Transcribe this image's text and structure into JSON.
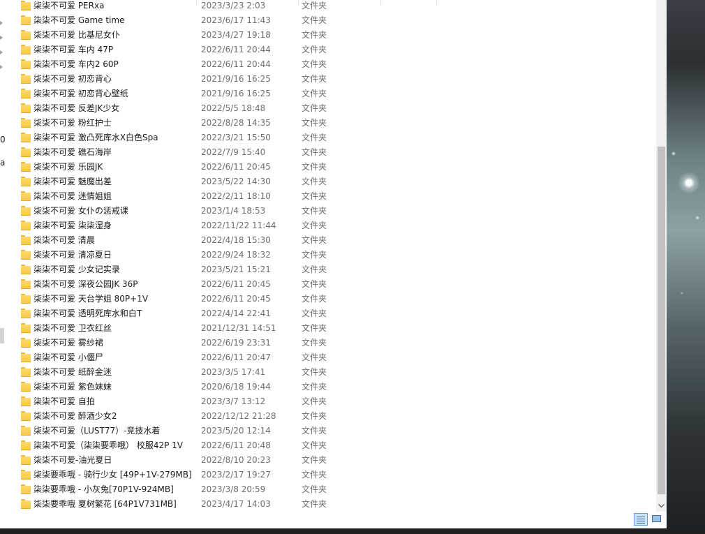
{
  "explorer": {
    "nav_fragments": [
      "0",
      "a"
    ],
    "rows": [
      {
        "name": "柒柒不可爱 PERxa",
        "date": "2023/3/23 2:03",
        "type": "文件夹"
      },
      {
        "name": "柒柒不可爱 Game time",
        "date": "2023/6/17 11:43",
        "type": "文件夹"
      },
      {
        "name": "柒柒不可爱 比基尼女仆",
        "date": "2023/4/27 19:18",
        "type": "文件夹"
      },
      {
        "name": "柒柒不可爱 车内 47P",
        "date": "2022/6/11 20:44",
        "type": "文件夹"
      },
      {
        "name": "柒柒不可爱 车内2 60P",
        "date": "2022/6/11 20:44",
        "type": "文件夹"
      },
      {
        "name": "柒柒不可爱 初恋背心",
        "date": "2021/9/16 16:25",
        "type": "文件夹"
      },
      {
        "name": "柒柒不可爱 初恋背心壁纸",
        "date": "2021/9/16 16:25",
        "type": "文件夹"
      },
      {
        "name": "柒柒不可爱 反差JK少女",
        "date": "2022/5/5 18:48",
        "type": "文件夹"
      },
      {
        "name": "柒柒不可爱 粉红护士",
        "date": "2022/8/28 14:35",
        "type": "文件夹"
      },
      {
        "name": "柒柒不可爱 激凸死库水X白色Spa",
        "date": "2022/3/21 15:50",
        "type": "文件夹"
      },
      {
        "name": "柒柒不可爱 礁石海岸",
        "date": "2022/7/9 15:40",
        "type": "文件夹"
      },
      {
        "name": "柒柒不可爱 乐园JK",
        "date": "2022/6/11 20:45",
        "type": "文件夹"
      },
      {
        "name": "柒柒不可爱 魅魔出差",
        "date": "2023/5/22 14:30",
        "type": "文件夹"
      },
      {
        "name": "柒柒不可爱 迷情姐姐",
        "date": "2022/2/11 18:10",
        "type": "文件夹"
      },
      {
        "name": "柒柒不可爱 女仆の惩戒课",
        "date": "2023/1/4 18:53",
        "type": "文件夹"
      },
      {
        "name": "柒柒不可爱 柒柒湿身",
        "date": "2022/11/22 11:44",
        "type": "文件夹"
      },
      {
        "name": "柒柒不可爱 清晨",
        "date": "2022/4/18 15:30",
        "type": "文件夹"
      },
      {
        "name": "柒柒不可爱 清凉夏日",
        "date": "2022/9/24 18:32",
        "type": "文件夹"
      },
      {
        "name": "柒柒不可爱 少女记实录",
        "date": "2023/5/21 15:21",
        "type": "文件夹"
      },
      {
        "name": "柒柒不可爱 深夜公园JK 36P",
        "date": "2022/6/11 20:45",
        "type": "文件夹"
      },
      {
        "name": "柒柒不可爱 天台学姐 80P+1V",
        "date": "2022/6/11 20:45",
        "type": "文件夹"
      },
      {
        "name": "柒柒不可爱 透明死库水和白T",
        "date": "2022/4/14 22:41",
        "type": "文件夹"
      },
      {
        "name": "柒柒不可爱 卫衣红丝",
        "date": "2021/12/31 14:51",
        "type": "文件夹"
      },
      {
        "name": "柒柒不可爱 雾纱裙",
        "date": "2022/6/19 23:31",
        "type": "文件夹"
      },
      {
        "name": "柒柒不可爱 小僵尸",
        "date": "2022/6/11 20:47",
        "type": "文件夹"
      },
      {
        "name": "柒柒不可爱 纸醉金迷",
        "date": "2023/3/5 17:41",
        "type": "文件夹"
      },
      {
        "name": "柒柒不可爱 紫色妹妹",
        "date": "2020/6/18 19:44",
        "type": "文件夹"
      },
      {
        "name": "柒柒不可爱 自拍",
        "date": "2023/3/7 13:12",
        "type": "文件夹"
      },
      {
        "name": "柒柒不可爱 醉酒少女2",
        "date": "2022/12/12 21:28",
        "type": "文件夹"
      },
      {
        "name": "柒柒不可爱（LUST77）-竞技水着",
        "date": "2023/5/20 12:14",
        "type": "文件夹"
      },
      {
        "name": "柒柒不可爱（柒柒要乖哦） 校服42P 1V",
        "date": "2022/6/11 20:48",
        "type": "文件夹"
      },
      {
        "name": "柒柒不可爱-油光夏日",
        "date": "2022/8/10 20:23",
        "type": "文件夹"
      },
      {
        "name": "柒柒要乖哦 - 骑行少女 [49P+1V-279MB]",
        "date": "2023/2/17 19:27",
        "type": "文件夹"
      },
      {
        "name": "柒柒要乖哦 - 小灰兔[70P1V-924MB]",
        "date": "2023/3/8 20:59",
        "type": "文件夹"
      },
      {
        "name": "柒柒要乖哦 夏树繁花 [64P1V731MB]",
        "date": "2023/4/17 14:03",
        "type": "文件夹"
      }
    ]
  },
  "icons": {
    "folder": "folder-icon",
    "scroll_down": "chevron-down-icon",
    "details_view": "details-view-icon",
    "large_icons_view": "large-icons-view-icon"
  },
  "colors": {
    "folder": "#f8c94a",
    "selected_view": "#cce4f7",
    "secondary_text": "#6d6d6d"
  }
}
